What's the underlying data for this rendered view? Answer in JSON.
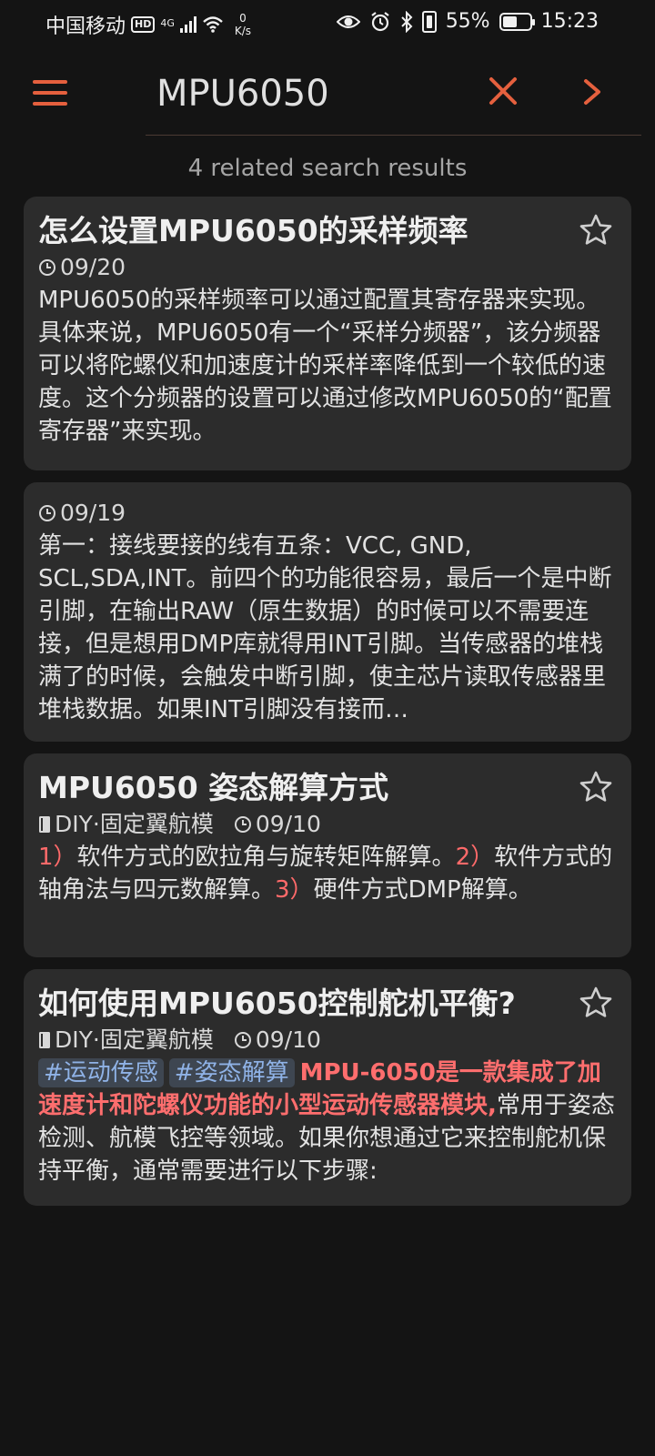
{
  "status_bar": {
    "carrier": "中国移动",
    "hd": "HD",
    "network": "4G",
    "net_speed_value": "0",
    "net_speed_unit": "K/s",
    "battery_percent": "55%",
    "battery_level": 0.55,
    "time": "15:23"
  },
  "search": {
    "query": "MPU6050",
    "result_count_text": "4 related search results"
  },
  "colors": {
    "accent": "#e5603e",
    "highlight": "#ff6e6e",
    "tag_text": "#8fb2e6",
    "card_bg": "#2c2c2c",
    "page_bg": "#141414"
  },
  "results": [
    {
      "title": "怎么设置MPU6050的采样频率",
      "date": "09/20",
      "body": "MPU6050的采样频率可以通过配置其寄存器来实现。具体来说，MPU6050有一个“采样分频器”，该分频器可以将陀螺仪和加速度计的采样率降低到一个较低的速度。这个分频器的设置可以通过修改MPU6050的“配置寄存器”来实现。",
      "starred": false
    },
    {
      "date": "09/19",
      "body": "第一：接线要接的线有五条：VCC, GND, SCL,SDA,INT。前四个的功能很容易，最后一个是中断引脚，在输出RAW（原生数据）的时候可以不需要连接，但是想用DMP库就得用INT引脚。当传感器的堆栈满了的时候，会触发中断引脚，使主芯片读取传感器里堆栈数据。如果INT引脚没有接而…"
    },
    {
      "title": "MPU6050 姿态解算方式",
      "book": "DIY·固定翼航模",
      "date": "09/10",
      "items": [
        {
          "num": "1）",
          "text": "软件方式的欧拉角与旋转矩阵解算。"
        },
        {
          "num": "2）",
          "text": "软件方式的轴角法与四元数解算。"
        },
        {
          "num": "3）",
          "text": "硬件方式DMP解算。"
        }
      ],
      "starred": false
    },
    {
      "title": "如何使用MPU6050控制舵机平衡?",
      "book": "DIY·固定翼航模",
      "date": "09/10",
      "tags": [
        "#运动传感",
        "#姿态解算"
      ],
      "highlight": "MPU-6050是一款集成了加速度计和陀螺仪功能的小型运动传感器模块,",
      "body": "常用于姿态检测、航模飞控等领域。如果你想通过它来控制舵机保持平衡，通常需要进行以下步骤:",
      "starred": false
    }
  ]
}
